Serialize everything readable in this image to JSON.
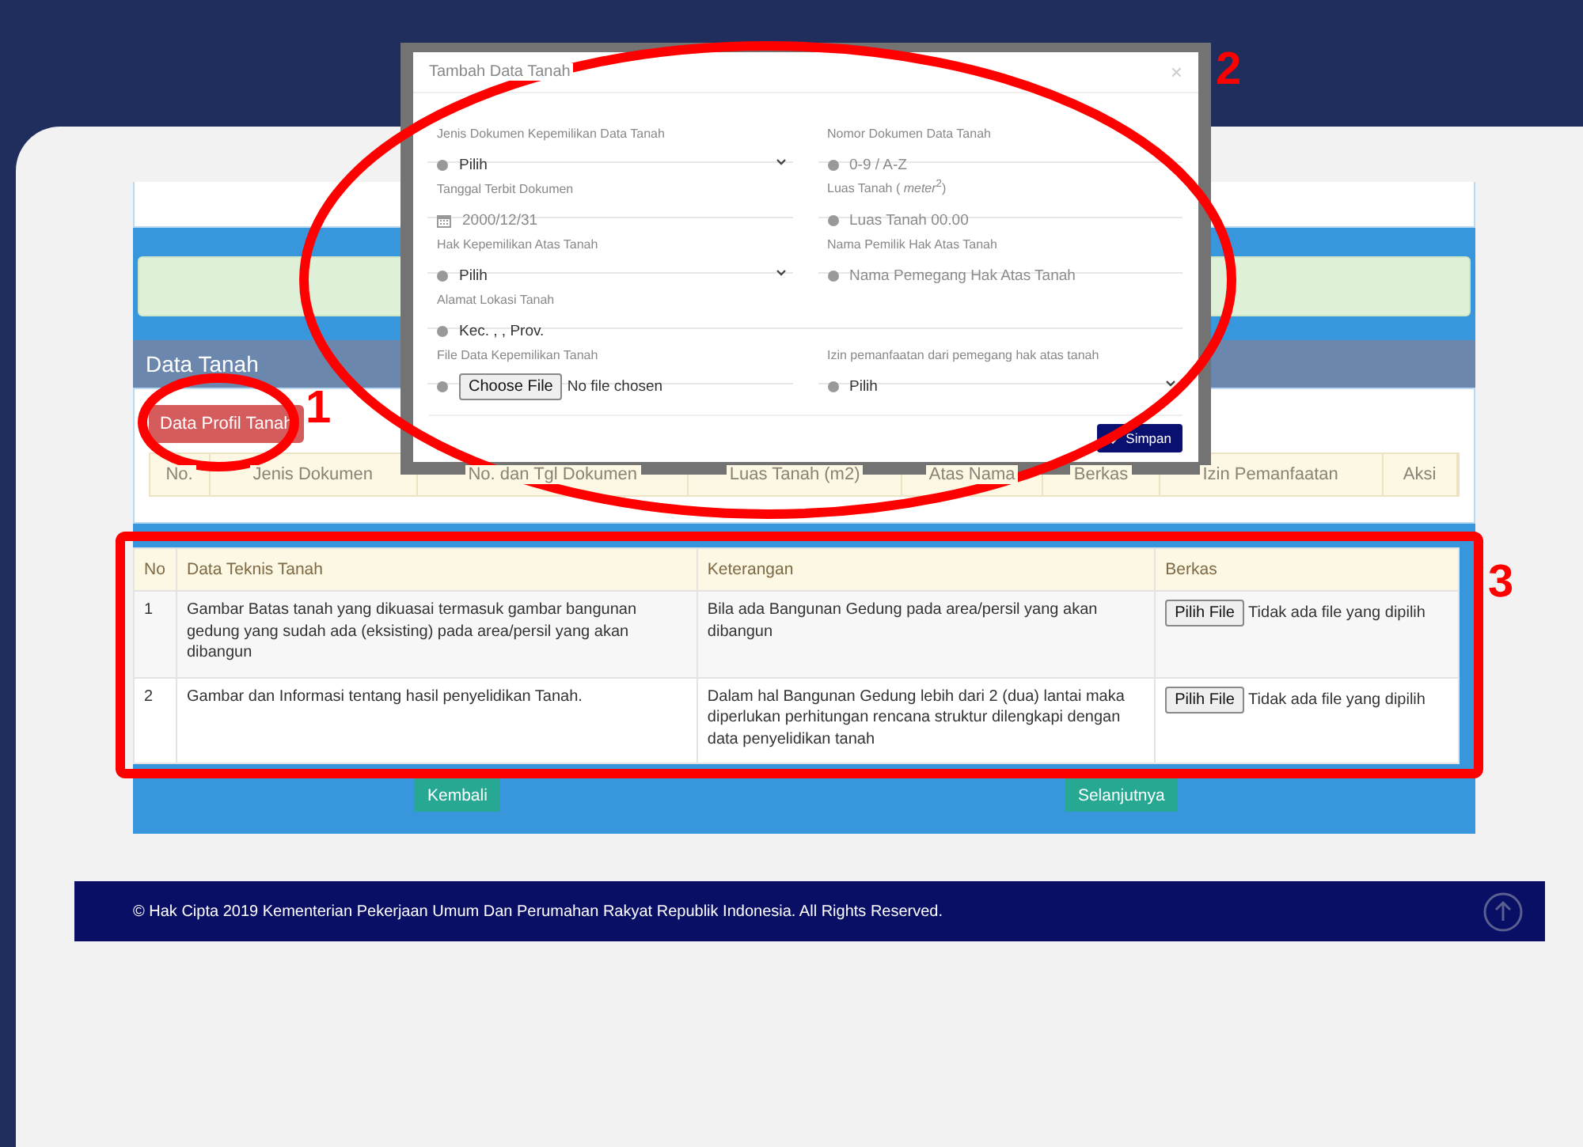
{
  "modal": {
    "title": "Tambah Data Tanah",
    "close": "×",
    "fields": [
      {
        "kind": "select",
        "label": "Jenis Dokumen Kepemilikan Data Tanah",
        "value": "Pilih",
        "wide": false
      },
      {
        "kind": "input",
        "label": "Nomor Dokumen Data Tanah",
        "placeholder": "0-9 / A-Z",
        "wide": false
      },
      {
        "kind": "date",
        "label": "Tanggal Terbit Dokumen",
        "placeholder": "2000/12/31",
        "wide": false
      },
      {
        "kind": "input",
        "label": "Luas Tanah ( *meter*$^{2}$)",
        "placeholder": "Luas Tanah 00.00",
        "wide": false
      },
      {
        "kind": "select",
        "label": "Hak Kepemilikan Atas Tanah",
        "value": "Pilih",
        "wide": false
      },
      {
        "kind": "input",
        "label": "Nama Pemilik Hak Atas Tanah",
        "placeholder": "Nama Pemegang Hak Atas Tanah",
        "wide": false
      },
      {
        "kind": "text",
        "label": "Alamat Lokasi Tanah",
        "value": "Kec. , , Prov.",
        "wide": true
      },
      {
        "kind": "file",
        "label": "File Data Kepemilikan Tanah",
        "button": "Choose File",
        "status": "No file chosen",
        "wide": false
      },
      {
        "kind": "select",
        "label": "Izin pemanfaatan dari pemegang hak atas tanah",
        "value": "Pilih",
        "wide": false
      }
    ],
    "submit": "Simpan"
  },
  "data_tanah": {
    "title": "Data Tanah",
    "button": "Data Profil Tanah",
    "columns": [
      "No.",
      "Jenis Dokumen",
      "No. dan Tgl Dokumen",
      "Luas Tanah (m2)",
      "Atas Nama",
      "Berkas",
      "Izin Pemanfaatan",
      "Aksi"
    ]
  },
  "technical_table": {
    "columns": [
      "No",
      "Data Teknis Tanah",
      "Keterangan",
      "Berkas"
    ],
    "rows": [
      {
        "no": "1",
        "data": "Gambar Batas tanah yang dikuasai termasuk gambar bangunan gedung yang sudah ada (eksisting) pada area/persil yang akan dibangun",
        "note": "Bila ada Bangunan Gedung pada area/persil yang akan dibangun",
        "button": "Pilih File",
        "status": "Tidak ada file yang dipilih"
      },
      {
        "no": "2",
        "data": "Gambar dan Informasi tentang hasil penyelidikan Tanah.",
        "note": "Dalam hal Bangunan Gedung lebih dari 2 (dua) lantai maka diperlukan perhitungan rencana struktur dilengkapi dengan data penyelidikan tanah",
        "button": "Pilih File",
        "status": "Tidak ada file yang dipilih"
      }
    ]
  },
  "buttons": [
    "Kembali",
    "Selanjutnya"
  ],
  "footer": {
    "text": "© Hak Cipta 2019 Kementerian Pekerjaan Umum Dan Perumahan Rakyat Republik Indonesia. All Rights Reserved."
  },
  "annotations": [
    {
      "kind": "ellipse",
      "label": "1"
    },
    {
      "kind": "ellipse",
      "label": "2"
    },
    {
      "kind": "rect",
      "label": "3"
    }
  ]
}
